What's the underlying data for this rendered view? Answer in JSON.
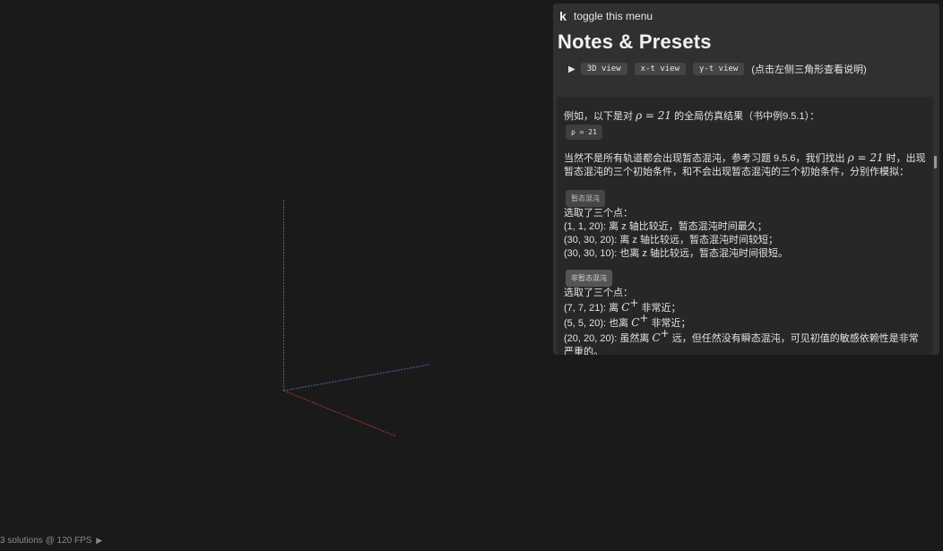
{
  "status": {
    "text": "3 solutions @ 120 FPS",
    "play_icon": "▶"
  },
  "menu": {
    "key": "k",
    "label": "toggle this menu"
  },
  "panel": {
    "title": "Notes & Presets",
    "triangle_icon": "▶",
    "views": [
      "3D view",
      "x-t view",
      "y-t view"
    ],
    "hint": "(点击左侧三角形查看说明)"
  },
  "notes": {
    "p1_prefix": "例如，以下是对 ",
    "p1_math": "ρ = 21",
    "p1_suffix": " 的全局仿真结果（书中例9.5.1）：",
    "preset_rho": "ρ = 21",
    "p2_a": "当然不是所有轨道都会出现暂态混沌，参考习题 9.5.6，我们找出 ",
    "p2_math": "ρ = 21",
    "p2_b": " 时，出现暂态混沌的三个初始条件，和不会出现暂态混沌的三个初始条件，分别作模拟：",
    "btn_transient": "暂态混沌",
    "transient_lines": [
      "选取了三个点：",
      "(1, 1, 20): 离 z 轴比较近，暂态混沌时间最久；",
      "(30, 30, 20): 离 z 轴比较远，暂态混沌时间较短；",
      "(30, 30, 10): 也离 z 轴比较远，暂态混沌时间很短。"
    ],
    "btn_non_transient": "非暂态混沌",
    "nt_line0": "选取了三个点：",
    "nt_line1_pre": "(7, 7, 21): 离 ",
    "nt_line1_post": " 非常近；",
    "nt_line2_pre": "(5, 5, 20): 也离 ",
    "nt_line2_post": " 非常近；",
    "nt_line3_pre": "(20, 20, 20): 虽然离 ",
    "nt_line3_post": " 远，但任然没有瞬态混沌，可见初值的敏感依赖性是非常严重的。",
    "c_plus_base": "C",
    "c_plus_sup": "+"
  },
  "colors": {
    "background": "#1a1a1a",
    "panel": "#303030",
    "axis_x": "#c0392b",
    "axis_y": "#b0502a",
    "axis_z": "#4a6fa5"
  }
}
